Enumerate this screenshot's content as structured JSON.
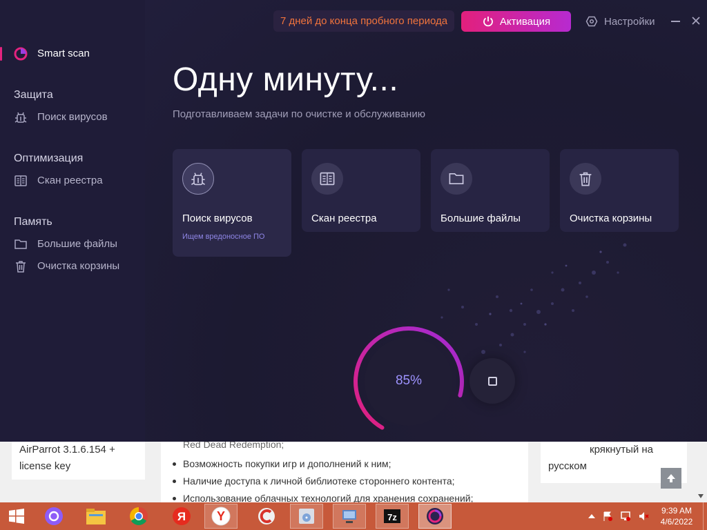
{
  "app": {
    "trial_text": "7 дней до конца пробного периода",
    "activate_label": "Активация",
    "settings_label": "Настройки",
    "title": "Одну минуту...",
    "subtitle": "Подготавливаем задачи по очистке и обслуживанию",
    "accent_color": "#e4237f",
    "progress_percent": 85,
    "progress_text": "85%"
  },
  "sidebar": {
    "brand": "Smart scan",
    "sections": [
      {
        "heading": "Защита",
        "items": [
          {
            "label": "Поиск вирусов",
            "icon": "bug-icon"
          }
        ]
      },
      {
        "heading": "Оптимизация",
        "items": [
          {
            "label": "Скан реестра",
            "icon": "registry-icon"
          }
        ]
      },
      {
        "heading": "Память",
        "items": [
          {
            "label": "Большие файлы",
            "icon": "folder-icon"
          },
          {
            "label": "Очистка корзины",
            "icon": "trash-icon"
          }
        ]
      }
    ]
  },
  "cards": [
    {
      "label": "Поиск вирусов",
      "status": "Ищем вредоносное ПО",
      "icon": "bug-icon"
    },
    {
      "label": "Скан реестра",
      "icon": "registry-icon"
    },
    {
      "label": "Большие файлы",
      "icon": "folder-icon"
    },
    {
      "label": "Очистка корзины",
      "icon": "trash-icon"
    }
  ],
  "webpage": {
    "left_card": [
      "AirParrot 3.1.6.154 +",
      "license key"
    ],
    "center_cut": "Red Dead Redemption;",
    "center_list": [
      "Возможность покупки игр и дополнений к ним;",
      "Наличие доступа к личной библиотеке стороннего контента;",
      "Использование облачных технологий для хранения сохранений;"
    ],
    "right_card": [
      "крякнутый на",
      "русском"
    ]
  },
  "taskbar": {
    "items": [
      "windows-start",
      "alice-assistant",
      "file-explorer",
      "chrome",
      "yandex",
      "yandex-browser",
      "ccleaner",
      "disk-utility",
      "network-app",
      "7zip",
      "smart-scan-app"
    ],
    "clock_time": "9:39 AM",
    "clock_date": "4/6/2022"
  }
}
